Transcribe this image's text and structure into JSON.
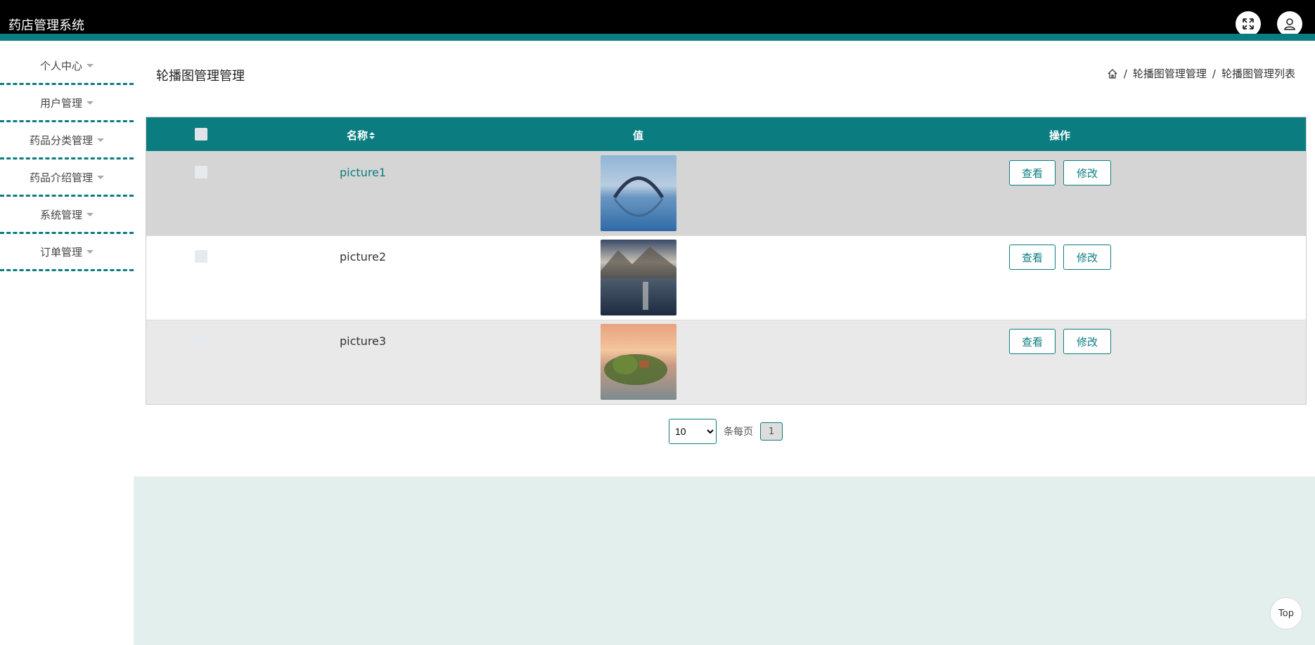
{
  "app": {
    "title": "药店管理系统"
  },
  "header_icons": [
    {
      "name": "fullscreen-icon"
    },
    {
      "name": "user-icon"
    }
  ],
  "sidebar": {
    "items": [
      {
        "label": "个人中心"
      },
      {
        "label": "用户管理"
      },
      {
        "label": "药品分类管理"
      },
      {
        "label": "药品介绍管理"
      },
      {
        "label": "系统管理"
      },
      {
        "label": "订单管理"
      }
    ]
  },
  "main": {
    "page_title": "轮播图管理管理",
    "breadcrumb": {
      "separator": "/",
      "items": [
        "轮播图管理管理",
        "轮播图管理列表"
      ]
    }
  },
  "table": {
    "headers": {
      "name": "名称",
      "sort_icon": "sort-icon",
      "value": "值",
      "actions": "操作"
    },
    "rows": [
      {
        "name": "picture1",
        "image": "bridge-lake-thumbnail",
        "view_label": "查看",
        "edit_label": "修改",
        "highlight": true
      },
      {
        "name": "picture2",
        "image": "mountain-lake-thumbnail",
        "view_label": "查看",
        "edit_label": "修改",
        "highlight": false
      },
      {
        "name": "picture3",
        "image": "sunset-island-thumbnail",
        "view_label": "查看",
        "edit_label": "修改",
        "highlight": false
      }
    ],
    "row_colors": [
      "#d5d5d5",
      "#ffffff",
      "#e9e9e9"
    ]
  },
  "pager": {
    "page_size": "10",
    "page_size_options": [
      "10"
    ],
    "per_page_label": "条每页",
    "current_page": "1"
  },
  "top_button": {
    "label": "Top"
  },
  "colors": {
    "accent": "#0b7d80",
    "header_bg": "#000000",
    "footer_band": "#e2efec"
  }
}
